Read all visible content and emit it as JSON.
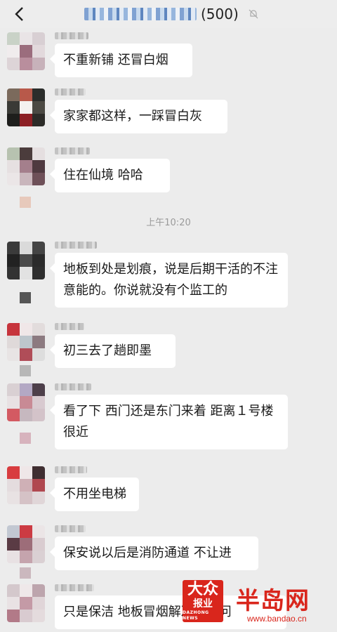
{
  "header": {
    "member_count": "(500)",
    "back_icon": "chevron-left-icon",
    "mute_icon": "bell-muted-icon"
  },
  "messages": [
    {
      "text": "不重新铺 还冒白烟"
    },
    {
      "text": "家家都这样，一踩冒白灰"
    },
    {
      "text": "住在仙境  哈哈"
    },
    {
      "text": "地板到处是划痕，说是后期干活的不注意能的。你说就没有个监工的"
    },
    {
      "text": "初三去了趟即墨"
    },
    {
      "text": "看了下 西门还是东门来着 距离１号楼很近"
    },
    {
      "text": "不用坐电梯"
    },
    {
      "text": "保安说以后是消防通道 不让进"
    },
    {
      "text": "只是保洁 地板冒烟解决不了问"
    }
  ],
  "timestamp": "上午10:20",
  "watermark": {
    "logo_line1": "大众",
    "logo_line2": "报业",
    "logo_line3": "DAZHONG NEWS",
    "brand": "半岛网",
    "url": "www.bandao.cn"
  },
  "colors": {
    "background": "#ececec",
    "bubble": "#ffffff",
    "watermark_red": "#d9261c"
  }
}
